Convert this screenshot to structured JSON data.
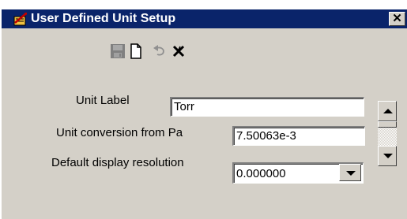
{
  "window": {
    "title": "User Defined Unit Setup",
    "close_label": "✕",
    "title_icon": "unit-setup-icon"
  },
  "toolbar": {
    "icons": [
      "save-icon",
      "new-document-icon",
      "undo-icon",
      "delete-icon"
    ]
  },
  "form": {
    "unit_label": {
      "label": "Unit Label",
      "value": "Torr"
    },
    "conversion": {
      "label": "Unit conversion from Pa",
      "value": "7.50063e-3"
    },
    "resolution": {
      "label": "Default display resolution",
      "value": "0.000000"
    }
  },
  "colors": {
    "titlebar": "#0a246a",
    "face": "#d4d0c8",
    "field": "#ffffff"
  }
}
